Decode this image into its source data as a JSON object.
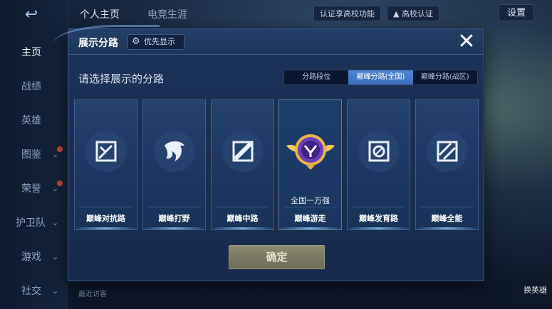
{
  "sidebar": {
    "items": [
      {
        "label": "主页",
        "active": true
      },
      {
        "label": "战绩"
      },
      {
        "label": "英雄"
      },
      {
        "label": "图鉴"
      },
      {
        "label": "荣誉"
      },
      {
        "label": "护卫队"
      },
      {
        "label": "游戏"
      },
      {
        "label": "社交"
      }
    ]
  },
  "topbar": {
    "tab_personal": "个人主页",
    "tab_esports": "电竞生涯",
    "verify_label": "认证享高校功能",
    "campus_label": "高校认证",
    "settings_label": "设置"
  },
  "footer": {
    "recent_visitors": "最近访客",
    "switch_label": "换英雄"
  },
  "modal": {
    "title": "展示分路",
    "priority_label": "优先显示",
    "subtitle": "请选择展示的分路",
    "segments": [
      "分路段位",
      "巅峰分路(全国)",
      "巅峰分路(战区)"
    ],
    "active_segment": 1,
    "cards": [
      {
        "label": "巅峰对抗路",
        "icon": "sword-lane-icon"
      },
      {
        "label": "巅峰打野",
        "icon": "jungle-dragon-icon"
      },
      {
        "label": "巅峰中路",
        "icon": "mid-lane-icon"
      },
      {
        "label": "巅峰游走",
        "icon": "roam-badge-icon",
        "rank": "全国一万强",
        "selected": true
      },
      {
        "label": "巅峰发育路",
        "icon": "farm-lane-icon"
      },
      {
        "label": "巅峰全能",
        "icon": "all-round-icon"
      }
    ],
    "confirm_label": "确定"
  },
  "colors": {
    "accent_blue": "#3a6fbd",
    "confirm_btn": "#7a7a64",
    "modal_bg": "#1a2f52"
  }
}
